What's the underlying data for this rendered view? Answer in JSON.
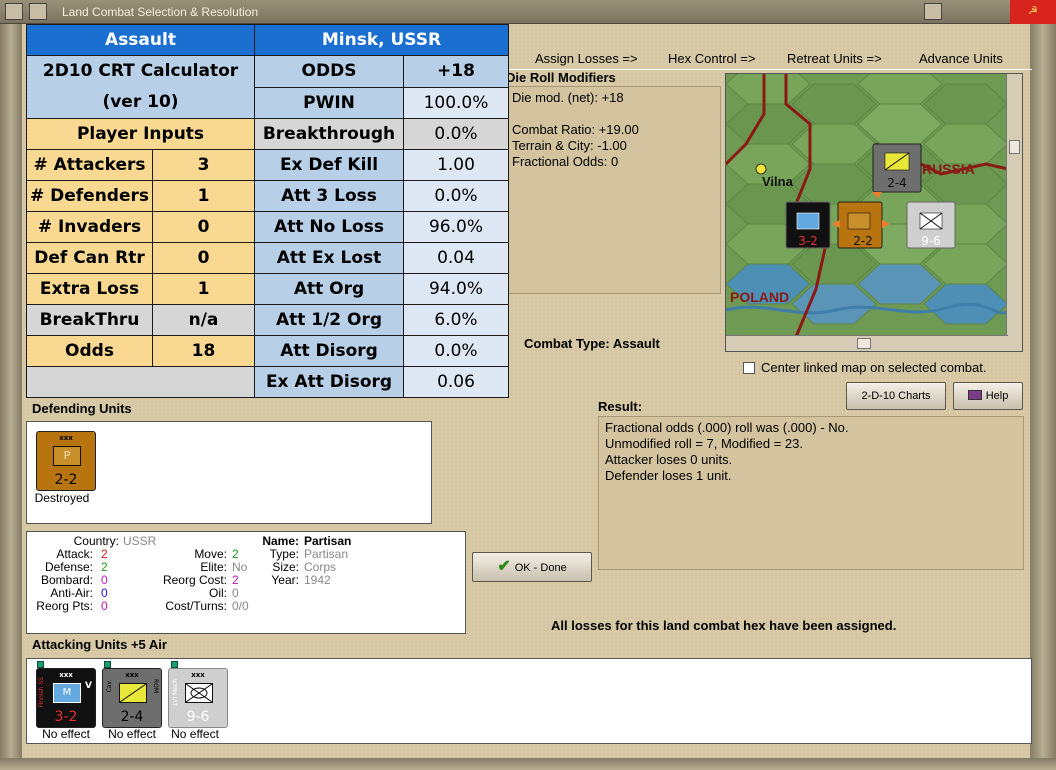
{
  "window": {
    "title": "Land Combat Selection & Resolution",
    "close_glyph": "☭"
  },
  "tabs": [
    "Assign Losses =>",
    "Hex Control =>",
    "Retreat Units =>",
    "Advance Units"
  ],
  "crt": {
    "header_left": "Assault",
    "header_right": "Minsk, USSR",
    "calc_title": "2D10 CRT Calculator",
    "calc_version": "(ver 10)",
    "player_inputs_label": "Player Inputs",
    "inputs": [
      {
        "label": "# Attackers",
        "value": "3"
      },
      {
        "label": "# Defenders",
        "value": "1"
      },
      {
        "label": "# Invaders",
        "value": "0"
      },
      {
        "label": "Def Can Rtr",
        "value": "0"
      },
      {
        "label": "Extra Loss",
        "value": "1"
      },
      {
        "label": "BreakThru",
        "value": "n/a"
      },
      {
        "label": "Odds",
        "value": "18"
      }
    ],
    "results": [
      {
        "label": "ODDS",
        "value": "+18"
      },
      {
        "label": "PWIN",
        "value": "100.0%"
      },
      {
        "label": "Breakthrough",
        "value": "0.0%"
      },
      {
        "label": "Ex Def Kill",
        "value": "1.00"
      },
      {
        "label": "Att 3 Loss",
        "value": "0.0%"
      },
      {
        "label": "Att No Loss",
        "value": "96.0%"
      },
      {
        "label": "Att Ex Lost",
        "value": "0.04"
      },
      {
        "label": "Att Org",
        "value": "94.0%"
      },
      {
        "label": "Att 1/2 Org",
        "value": "6.0%"
      },
      {
        "label": "Att Disorg",
        "value": "0.0%"
      },
      {
        "label": "Ex Att Disorg",
        "value": "0.06"
      }
    ]
  },
  "drm": {
    "title": "Die Roll Modifiers",
    "lines": [
      "Die mod. (net): +18",
      "",
      "Combat Ratio: +19.00",
      "Terrain & City: -1.00",
      "Fractional Odds: 0"
    ]
  },
  "map": {
    "labels": {
      "city": "Vilna",
      "country1": "RUSSIA",
      "country2": "POLAND"
    },
    "units": [
      {
        "name": "3-2",
        "str": "3-2",
        "size": "xxx"
      },
      {
        "name": "2-4",
        "str": "2-4",
        "size": "xxx"
      },
      {
        "name": "2-2",
        "str": "2-2",
        "size": "xxx"
      },
      {
        "name": "9-6",
        "str": "9-6",
        "size": "xxx"
      }
    ]
  },
  "center_map_label": "Center linked map on selected combat.",
  "combat_type": "Combat Type:  Assault",
  "buttons": {
    "charts": "2-D-10 Charts",
    "help": "Help",
    "ok": "OK - Done"
  },
  "result": {
    "title": "Result:",
    "lines": [
      "Fractional odds (.000) roll was (.000)  - No.",
      "Unmodified roll = 7, Modified = 23.",
      "Attacker loses 0 units.",
      "Defender loses 1 unit."
    ]
  },
  "defending": {
    "title": "Defending Units",
    "unit": {
      "size": "xxx",
      "letter": "P",
      "str": "2-2",
      "caption": "Destroyed"
    }
  },
  "info": {
    "country_label": "Country:",
    "country": "USSR",
    "attack_label": "Attack:",
    "attack": "2",
    "defense_label": "Defense:",
    "defense": "2",
    "bombard_label": "Bombard:",
    "bombard": "0",
    "antiair_label": "Anti-Air:",
    "antiair": "0",
    "reorgpts_label": "Reorg Pts:",
    "reorgpts": "0",
    "move_label": "Move:",
    "move": "2",
    "elite_label": "Elite:",
    "elite": "No",
    "reorgcost_label": "Reorg Cost:",
    "reorgcost": "2",
    "oil_label": "Oil:",
    "oil": "0",
    "costturns_label": "Cost/Turns:",
    "costturns": "0/0",
    "name_label": "Name:",
    "name": "Partisan",
    "type_label": "Type:",
    "type": "Partisan",
    "size_label": "Size:",
    "size": "Corps",
    "year_label": "Year:",
    "year": "1942"
  },
  "attacking": {
    "title": "Attacking Units +5 Air",
    "units": [
      {
        "size": "xxx",
        "str": "3-2",
        "side": "Finnish SS",
        "tag": "V",
        "caption": "No effect"
      },
      {
        "size": "xxx",
        "str": "2-4",
        "side": "Cav",
        "tag": "ROM",
        "caption": "No effect"
      },
      {
        "size": "xxx",
        "str": "9-6",
        "side": "LVI Mech",
        "tag": "",
        "caption": "No effect"
      }
    ]
  },
  "status_message": "All losses for this land combat hex have been assigned.",
  "colors": {
    "crt_header": "#1a6fd0",
    "crt_input": "#f9d991",
    "crt_result": "#b8cfe8",
    "partisan_counter": "#b8740f",
    "map_green": "#6f9a53"
  }
}
